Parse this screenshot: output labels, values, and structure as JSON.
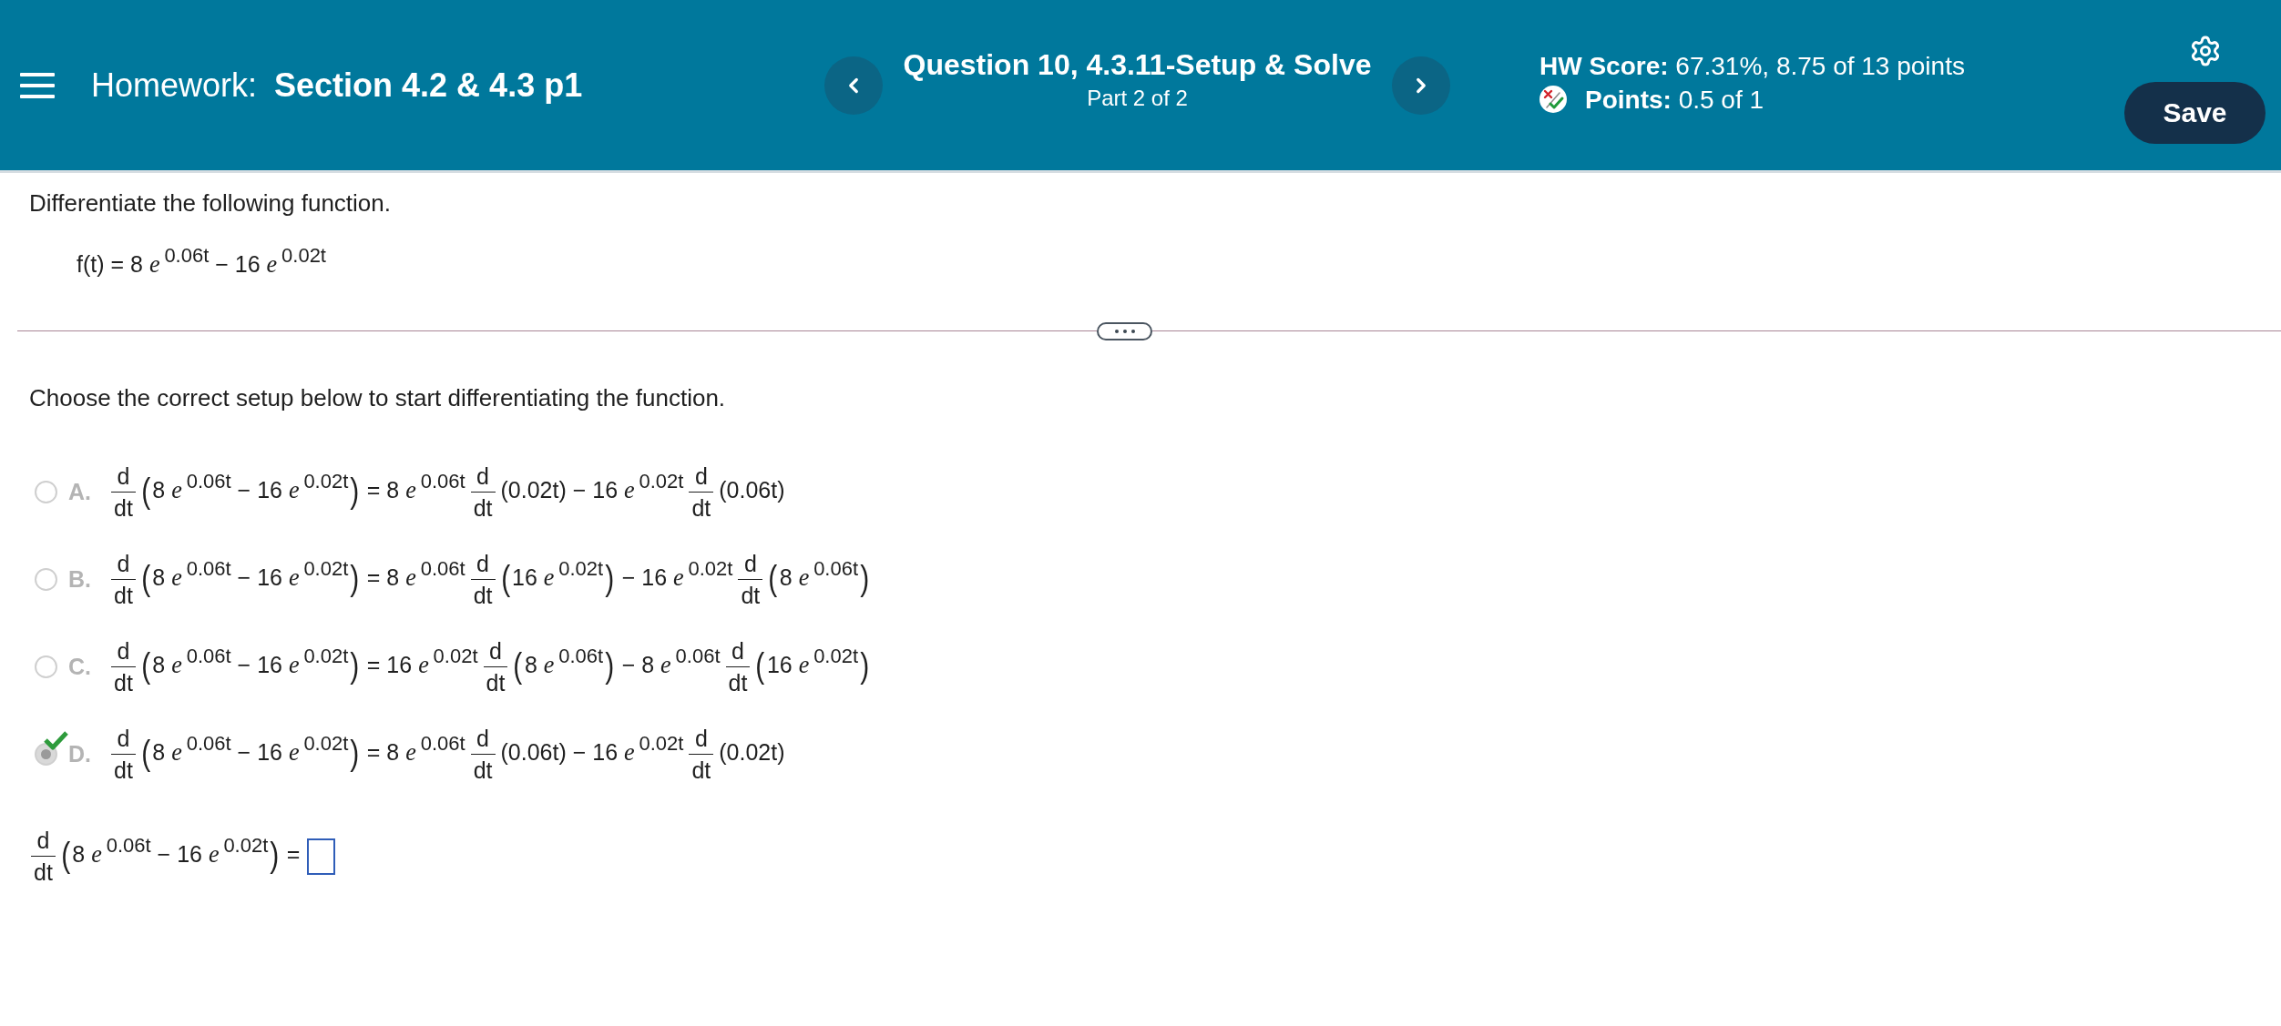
{
  "header": {
    "homework": "Homework: **Section 4.2 & 4.3 p1**",
    "question_title": "Question 10, 4.3.11-Setup & Solve",
    "question_part": "Part 2 of 2",
    "hw_score": "**HW Score:** 67.31%, 8.75 of 13 points",
    "points": "**Points:** 0.5 of 1",
    "save_button": "Save"
  },
  "problem": {
    "instruction": "Differentiate the following function.",
    "function": [
      {
        "kind": "text",
        "text": "f(t) = 8 *e*$^{0.06t}$ − 16 *e*$^{0.02t}$"
      }
    ]
  },
  "setup": {
    "prompt": "Choose the correct setup below to start differentiating the function.",
    "options": [
      {
        "letter": "A.",
        "selected": false,
        "correct": false,
        "disabled": true,
        "expression": [
          {
            "kind": "frac",
            "numerator": "d",
            "denominator": "dt"
          },
          {
            "kind": "group",
            "open": "(",
            "text": "8 *e*$^{0.06t}$ − 16 *e*$^{0.02t}$",
            "close": ")"
          },
          {
            "kind": "text",
            "text": "= 8 *e*$^{0.06t}$"
          },
          {
            "kind": "frac",
            "numerator": "d",
            "denominator": "dt"
          },
          {
            "kind": "text",
            "text": "(0.02t) − 16 *e*$^{0.02t}$"
          },
          {
            "kind": "frac",
            "numerator": "d",
            "denominator": "dt"
          },
          {
            "kind": "text",
            "text": "(0.06t)"
          }
        ]
      },
      {
        "letter": "B.",
        "selected": false,
        "correct": false,
        "disabled": true,
        "expression": [
          {
            "kind": "frac",
            "numerator": "d",
            "denominator": "dt"
          },
          {
            "kind": "group",
            "open": "(",
            "text": "8 *e*$^{0.06t}$ − 16 *e*$^{0.02t}$",
            "close": ")"
          },
          {
            "kind": "text",
            "text": "= 8 *e*$^{0.06t}$"
          },
          {
            "kind": "frac",
            "numerator": "d",
            "denominator": "dt"
          },
          {
            "kind": "group",
            "open": "(",
            "text": "16 *e*$^{0.02t}$",
            "close": ")"
          },
          {
            "kind": "text",
            "text": "− 16 *e*$^{0.02t}$"
          },
          {
            "kind": "frac",
            "numerator": "d",
            "denominator": "dt"
          },
          {
            "kind": "group",
            "open": "(",
            "text": "8 *e*$^{0.06t}$",
            "close": ")"
          }
        ]
      },
      {
        "letter": "C.",
        "selected": false,
        "correct": false,
        "disabled": true,
        "expression": [
          {
            "kind": "frac",
            "numerator": "d",
            "denominator": "dt"
          },
          {
            "kind": "group",
            "open": "(",
            "text": "8 *e*$^{0.06t}$ − 16 *e*$^{0.02t}$",
            "close": ")"
          },
          {
            "kind": "text",
            "text": "= 16 *e*$^{0.02t}$"
          },
          {
            "kind": "frac",
            "numerator": "d",
            "denominator": "dt"
          },
          {
            "kind": "group",
            "open": "(",
            "text": "8 *e*$^{0.06t}$",
            "close": ")"
          },
          {
            "kind": "text",
            "text": "− 8 *e*$^{0.06t}$"
          },
          {
            "kind": "frac",
            "numerator": "d",
            "denominator": "dt"
          },
          {
            "kind": "group",
            "open": "(",
            "text": "16 *e*$^{0.02t}$",
            "close": ")"
          }
        ]
      },
      {
        "letter": "D.",
        "selected": true,
        "correct": true,
        "disabled": true,
        "expression": [
          {
            "kind": "frac",
            "numerator": "d",
            "denominator": "dt"
          },
          {
            "kind": "group",
            "open": "(",
            "text": "8 *e*$^{0.06t}$ − 16 *e*$^{0.02t}$",
            "close": ")"
          },
          {
            "kind": "text",
            "text": "= 8 *e*$^{0.06t}$"
          },
          {
            "kind": "frac",
            "numerator": "d",
            "denominator": "dt"
          },
          {
            "kind": "text",
            "text": "(0.06t) − 16 *e*$^{0.02t}$"
          },
          {
            "kind": "frac",
            "numerator": "d",
            "denominator": "dt"
          },
          {
            "kind": "text",
            "text": "(0.02t)"
          }
        ]
      }
    ]
  },
  "answer": {
    "expression": [
      {
        "kind": "frac",
        "numerator": "d",
        "denominator": "dt"
      },
      {
        "kind": "group",
        "open": "(",
        "text": "8 *e*$^{0.06t}$ − 16 *e*$^{0.02t}$",
        "close": ")"
      },
      {
        "kind": "text",
        "text": "="
      }
    ]
  }
}
